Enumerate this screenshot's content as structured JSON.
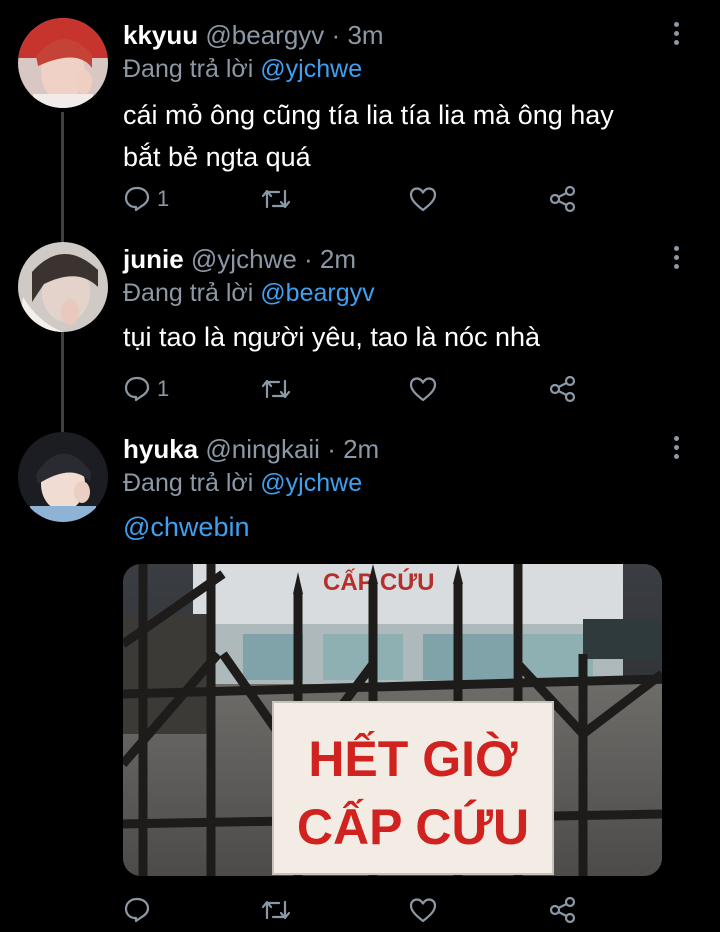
{
  "tweets": [
    {
      "name": "kkyuu",
      "handle": "@beargyv",
      "separator": "·",
      "time": "3m",
      "reply_prefix": "Đang trả lời",
      "reply_to": "@yjchwe",
      "text_lines": [
        "cái mỏ ông cũng tía lia tía lia mà ông hay",
        "bắt bẻ ngta quá"
      ],
      "reply_count": "1"
    },
    {
      "name": "junie",
      "handle": "@yjchwe",
      "separator": "·",
      "time": "2m",
      "reply_prefix": "Đang trả lời",
      "reply_to": "@beargyv",
      "text_lines": [
        "tụi tao là người yêu, tao là nóc nhà"
      ],
      "reply_count": "1"
    },
    {
      "name": "hyuka",
      "handle": "@ningkaii",
      "separator": "·",
      "time": "2m",
      "reply_prefix": "Đang trả lời",
      "reply_to": "@yjchwe",
      "text_mention": "@chwebin",
      "image": {
        "building_sign": "CẤP CỨU",
        "sign_line1": "HẾT GIỜ",
        "sign_line2": "CẤP CỨU"
      }
    }
  ],
  "colors": {
    "background": "#000000",
    "mention": "#3fa0f0",
    "secondary_text": "#8b98a5",
    "sign_text": "#d0221f"
  },
  "icons": [
    "reply-icon",
    "retweet-icon",
    "like-icon",
    "share-icon",
    "more-options-icon"
  ]
}
